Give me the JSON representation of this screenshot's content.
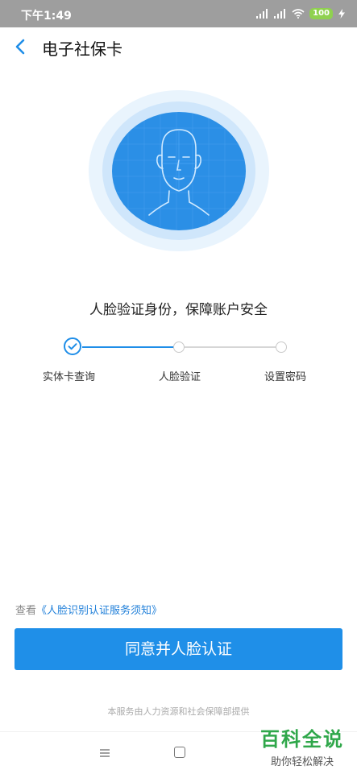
{
  "status_bar": {
    "time": "下午1:49",
    "battery": "100"
  },
  "nav": {
    "title": "电子社保卡"
  },
  "tagline": "人脸验证身份，保障账户安全",
  "steps": [
    {
      "label": "实体卡查询",
      "state": "done"
    },
    {
      "label": "人脸验证",
      "state": "todo"
    },
    {
      "label": "设置密码",
      "state": "todo"
    }
  ],
  "notice": {
    "prefix": "查看",
    "link": "《人脸识别认证服务须知》"
  },
  "agree_button": "同意并人脸认证",
  "provider_text": "本服务由人力资源和社会保障部提供",
  "watermark": {
    "title": "百科全说",
    "subtitle": "助你轻松解决"
  },
  "colors": {
    "accent": "#1f8fe8",
    "face_circle": "#2b8fe6",
    "status_bar": "#9e9e9e",
    "watermark": "#2fa74a"
  }
}
